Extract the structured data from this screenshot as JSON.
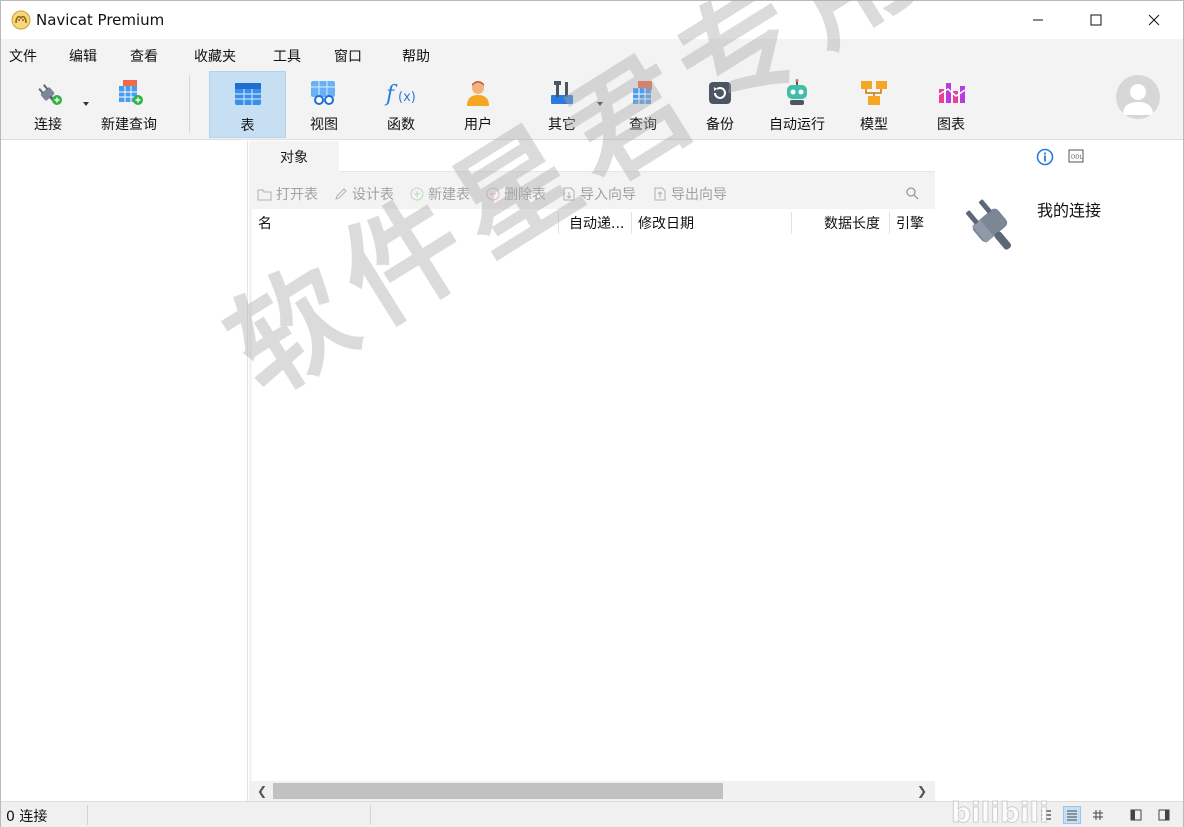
{
  "window": {
    "title": "Navicat Premium"
  },
  "menu": [
    "文件",
    "编辑",
    "查看",
    "收藏夹",
    "工具",
    "窗口",
    "帮助"
  ],
  "toolbar": {
    "connect": "连接",
    "new_query": "新建查询",
    "table": "表",
    "view": "视图",
    "function": "函数",
    "user": "用户",
    "other": "其它",
    "query": "查询",
    "backup": "备份",
    "automation": "自动运行",
    "model": "模型",
    "chart": "图表",
    "active_tab": "表"
  },
  "objects": {
    "tab_label": "对象",
    "actions": {
      "open_table": "打开表",
      "design_table": "设计表",
      "new_table": "新建表",
      "delete_table": "删除表",
      "import_wizard": "导入向导",
      "export_wizard": "导出向导"
    },
    "columns": [
      "名",
      "自动递...",
      "修改日期",
      "数据长度",
      "引擎"
    ]
  },
  "right_panel": {
    "title": "我的连接"
  },
  "status": {
    "connections": "0 连接"
  },
  "watermark": {
    "text": "软件星君专用",
    "corner": "bilibili"
  },
  "colors": {
    "active_tab_bg": "#c7dff3",
    "toolbar_bg": "#f3f3f3",
    "disabled_text": "#a2a2a2"
  }
}
